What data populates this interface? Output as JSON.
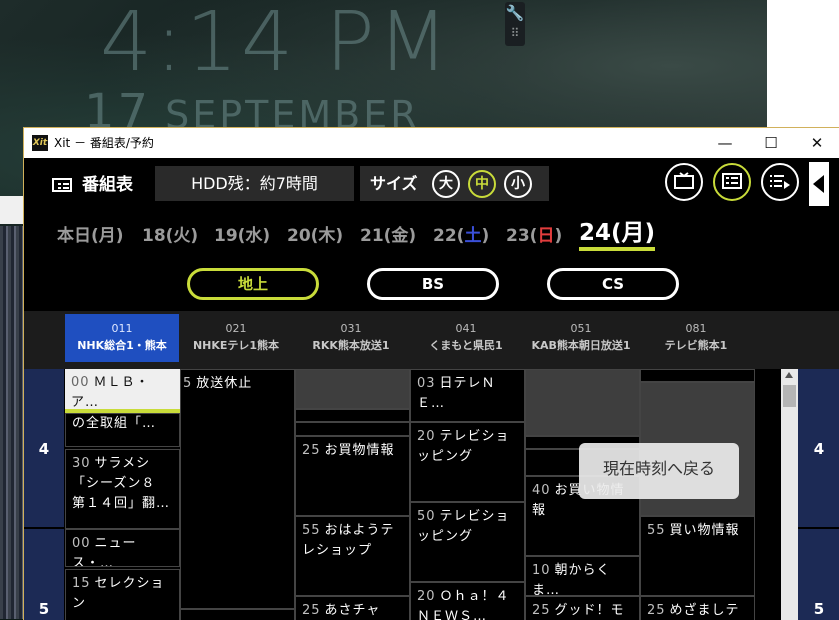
{
  "wallpaper": {
    "time": "4:14 PM",
    "day": "17",
    "month": "SEPTEMBER"
  },
  "window": {
    "title": "Xit － 番組表/予約",
    "app_icon": "Xit",
    "minimize": "—",
    "maximize": "☐",
    "close": "✕"
  },
  "toolbar": {
    "title": "番組表",
    "hdd": "HDD残：約7時間",
    "size_label": "サイズ",
    "size_large": "大",
    "size_medium": "中",
    "size_small": "小",
    "icons": [
      "tv-icon",
      "program-guide-icon",
      "reservation-list-icon"
    ]
  },
  "dates": [
    {
      "text": "本日(月)"
    },
    {
      "text": "18(火)"
    },
    {
      "text": "19(水)"
    },
    {
      "text": "20(木)"
    },
    {
      "text": "21(金)",
      "day": ""
    },
    {
      "pre": "22(",
      "mid": "土",
      "post": ")"
    },
    {
      "pre": "23(",
      "mid": "日",
      "post": ")"
    },
    {
      "text": "24(月)"
    }
  ],
  "broadcast": {
    "terrestrial": "地上",
    "bs": "BS",
    "cs": "CS"
  },
  "channels": [
    {
      "num": "011",
      "name": "NHK総合1・熊本"
    },
    {
      "num": "021",
      "name": "NHKEテレ1熊本"
    },
    {
      "num": "031",
      "name": "RKK熊本放送1"
    },
    {
      "num": "041",
      "name": "くまもと県民1"
    },
    {
      "num": "051",
      "name": "KAB熊本朝日放送1"
    },
    {
      "num": "081",
      "name": "テレビ熊本1"
    }
  ],
  "hours": {
    "four": "4",
    "five": "5"
  },
  "programs": {
    "c1a_min": "00",
    "c1a_title": "ＭＬＢ・ア…",
    "c1a_cont": "の全取組「…",
    "c1b_min": "30",
    "c1b_title": "サラメシ「シーズン８　第１４回」翻…",
    "c1c_min": "00",
    "c1c_title": "ニュース・…",
    "c1d_min": "15",
    "c1d_title": "セレクション",
    "c2a_min": "5",
    "c2a_title": "放送休止",
    "c3b_min": "25",
    "c3b_title": "お買物情報",
    "c3c_min": "55",
    "c3c_title": "おはようテレショップ",
    "c3d_min": "25",
    "c3d_title": "あさチャン！",
    "c4a_min": "03",
    "c4a_title": "日テレＮＥ…",
    "c4b_min": "20",
    "c4b_title": "テレビショッピング",
    "c4c_min": "50",
    "c4c_title": "テレビショッピング",
    "c4d_min": "20",
    "c4d_title": "Ｏｈａ！４ ＮＥＷＳ…",
    "c5b_min": "40",
    "c5b_title": "お買い物情報",
    "c5c_min": "10",
    "c5c_title": "朝からくま…",
    "c5d_min": "25",
    "c5d_title": "グッド！モー",
    "c6b_min": "55",
    "c6b_title": "買い物情報",
    "c6c_min": "25",
    "c6c_title": "めざましテレ"
  },
  "now_button": "現在時刻へ戻る",
  "colors": {
    "accent": "#c9dc3a",
    "selected_channel": "#1f4fc0",
    "hour_column": "#1c2a55",
    "window_border": "#d1b15b"
  }
}
